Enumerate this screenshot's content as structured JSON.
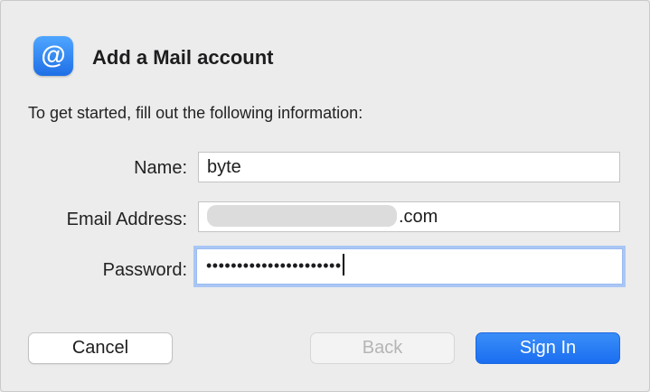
{
  "header": {
    "icon_glyph": "@",
    "icon_name": "mail-at-icon",
    "title": "Add a Mail account"
  },
  "intro": "To get started, fill out the following information:",
  "form": {
    "name": {
      "label": "Name:",
      "value": "byte"
    },
    "email": {
      "label": "Email Address:",
      "value_suffix": ".com"
    },
    "password": {
      "label": "Password:",
      "masked_value": "••••••••••••••••••••••",
      "focused": true
    }
  },
  "buttons": {
    "cancel": "Cancel",
    "back": "Back",
    "sign_in": "Sign In"
  },
  "colors": {
    "accent": "#1b6ef0",
    "focus_ring": "#a9c6f5",
    "background": "#ececec"
  }
}
